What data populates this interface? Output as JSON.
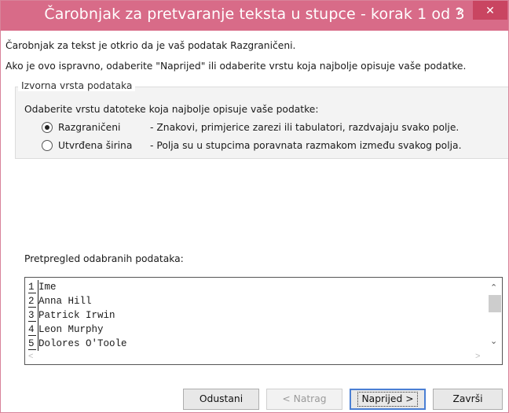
{
  "window": {
    "title": "Čarobnjak za pretvaranje teksta u stupce - korak 1 od 3",
    "help_glyph": "?",
    "close_glyph": "✕"
  },
  "intro": {
    "line1": "Čarobnjak za tekst je otkrio da je vaš podatak Razgraničeni.",
    "line2": "Ako je ovo ispravno, odaberite \"Naprijed\" ili odaberite vrstu koja najbolje opisuje vaše podatke."
  },
  "source_group": {
    "label": "Izvorna vrsta podataka",
    "prompt": "Odaberite vrstu datoteke koja najbolje opisuje vaše podatke:",
    "options": [
      {
        "label": "Razgraničeni",
        "description": "- Znakovi, primjerice zarezi ili tabulatori, razdvajaju svako polje.",
        "selected": true
      },
      {
        "label": "Utvrđena širina",
        "description": "- Polja su u stupcima poravnata razmakom između svakog polja.",
        "selected": false
      }
    ]
  },
  "preview": {
    "label": "Pretpregled odabranih podataka:",
    "rows": [
      {
        "num": "1",
        "text": "Ime"
      },
      {
        "num": "2",
        "text": "Anna Hill"
      },
      {
        "num": "3",
        "text": "Patrick Irwin"
      },
      {
        "num": "4",
        "text": "Leon Murphy"
      },
      {
        "num": "5",
        "text": "Dolores O'Toole"
      }
    ]
  },
  "buttons": {
    "cancel": "Odustani",
    "back": "< Natrag",
    "next": "Naprijed >",
    "finish": "Završi"
  },
  "colors": {
    "titlebar": "#d86b88",
    "close": "#c94561",
    "default_button_border": "#4a7fd4"
  }
}
